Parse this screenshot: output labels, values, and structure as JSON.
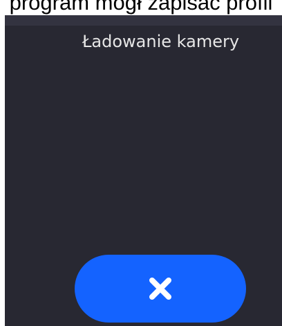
{
  "document": {
    "caption": "program mógł zapisać profil"
  },
  "screen": {
    "title": "Ładowanie kamery",
    "cancel_button": {
      "icon": "close-icon",
      "color": "#1463ff"
    },
    "colors": {
      "background": "#282832",
      "text": "#e6e6e6"
    }
  }
}
